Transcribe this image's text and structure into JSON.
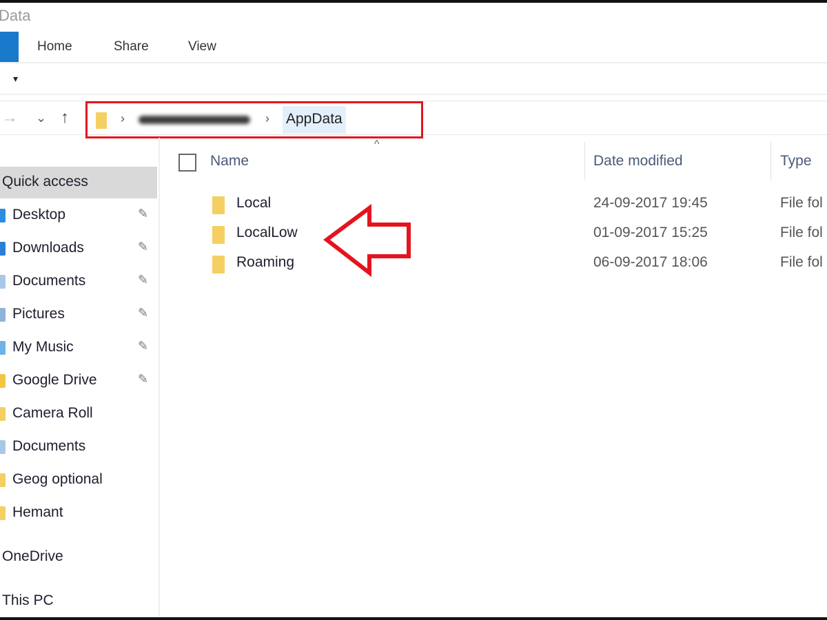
{
  "window": {
    "title": "Data"
  },
  "ribbon": {
    "tabs": [
      {
        "label": "Home"
      },
      {
        "label": "Share"
      },
      {
        "label": "View"
      }
    ],
    "file_tab_color": "#1979ca"
  },
  "quick_access_toolbar": {
    "dropdown_glyph": "▾"
  },
  "navigation": {
    "forward_glyph": "→",
    "recent_glyph": "⌄",
    "up_glyph": "↑",
    "breadcrumb": {
      "separator": "›",
      "current": "AppData",
      "highlight_color": "#e4141e"
    }
  },
  "sidebar": {
    "items": [
      {
        "label": "Quick access",
        "selected": true
      },
      {
        "label": "Desktop",
        "pinned": true,
        "icon": "desktop-icon"
      },
      {
        "label": "Downloads",
        "pinned": true,
        "icon": "downloads-icon"
      },
      {
        "label": "Documents",
        "pinned": true,
        "icon": "documents-icon"
      },
      {
        "label": "Pictures",
        "pinned": true,
        "icon": "pictures-icon"
      },
      {
        "label": "My Music",
        "pinned": true,
        "icon": "music-icon"
      },
      {
        "label": "Google Drive",
        "pinned": true,
        "icon": "google-drive-icon"
      },
      {
        "label": "Camera Roll",
        "icon": "folder-icon"
      },
      {
        "label": "Documents",
        "icon": "documents-icon"
      },
      {
        "label": "Geog optional",
        "icon": "folder-icon"
      },
      {
        "label": "Hemant",
        "icon": "folder-icon"
      },
      {
        "label": "OneDrive"
      },
      {
        "label": "This PC"
      }
    ],
    "pin_glyph": "📌"
  },
  "file_list": {
    "columns": [
      {
        "label": "Name"
      },
      {
        "label": "Date modified"
      },
      {
        "label": "Type"
      }
    ],
    "sort_glyph": "^",
    "rows": [
      {
        "name": "Local",
        "date": "24-09-2017 19:45",
        "type": "File fol"
      },
      {
        "name": "LocalLow",
        "date": "01-09-2017 15:25",
        "type": "File fol"
      },
      {
        "name": "Roaming",
        "date": "06-09-2017 18:06",
        "type": "File fol"
      }
    ]
  },
  "annotation": {
    "arrow_color": "#e4141e"
  }
}
